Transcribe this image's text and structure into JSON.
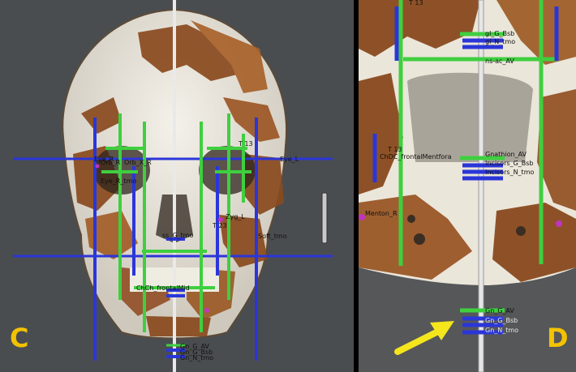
{
  "panels": [
    {
      "id": "C",
      "label": "C"
    },
    {
      "id": "D",
      "label": "D"
    }
  ],
  "labels_c": {
    "eye_r": "Eye_R",
    "orb_r": "Orb_R",
    "orb_x_r": "Orb_X_R",
    "eye_l": "Eye_L",
    "eye_r_tmo": "Eye_R_tmo",
    "t13": "T 13",
    "zyg_l": "Zyg_L",
    "t23": "T 23",
    "ss_g_tmo": "ss_G_tmo",
    "soft_tmo": "Soft_tmo",
    "mid_chin": "ChCh_frontalMid",
    "gn_g": "Gn_G_AV",
    "gn_bs": "Gn_G_Bsb",
    "gn_tmo": "Gn_N_tmo"
  },
  "labels_d": {
    "top_13": "T 13",
    "top_g": "gl_G_Bsb",
    "top_n": "gl_N_tmo",
    "top_ns": "ns-ac_AV",
    "t13": "T 13",
    "left": "ChDC_frontalMentfora",
    "incisors_av": "Gnathion_AV",
    "incisors_bs": "Incisors_G_Bsb",
    "incisors_tmo": "Incisors_N_tmo",
    "mid_left": "Menton_R",
    "bottom_av": "Gn_G_AV",
    "bottom_bs": "Gn_G_Bsb",
    "bottom_tmo": "Gn_N_tmo"
  },
  "colors": {
    "green": "#3fcf3f",
    "blue": "#2b36d9",
    "yellow_arrow": "#f5e51d",
    "panel_label": "#f3c200",
    "bone": "#e9e4d8",
    "sediment": "#8a4a1e"
  }
}
